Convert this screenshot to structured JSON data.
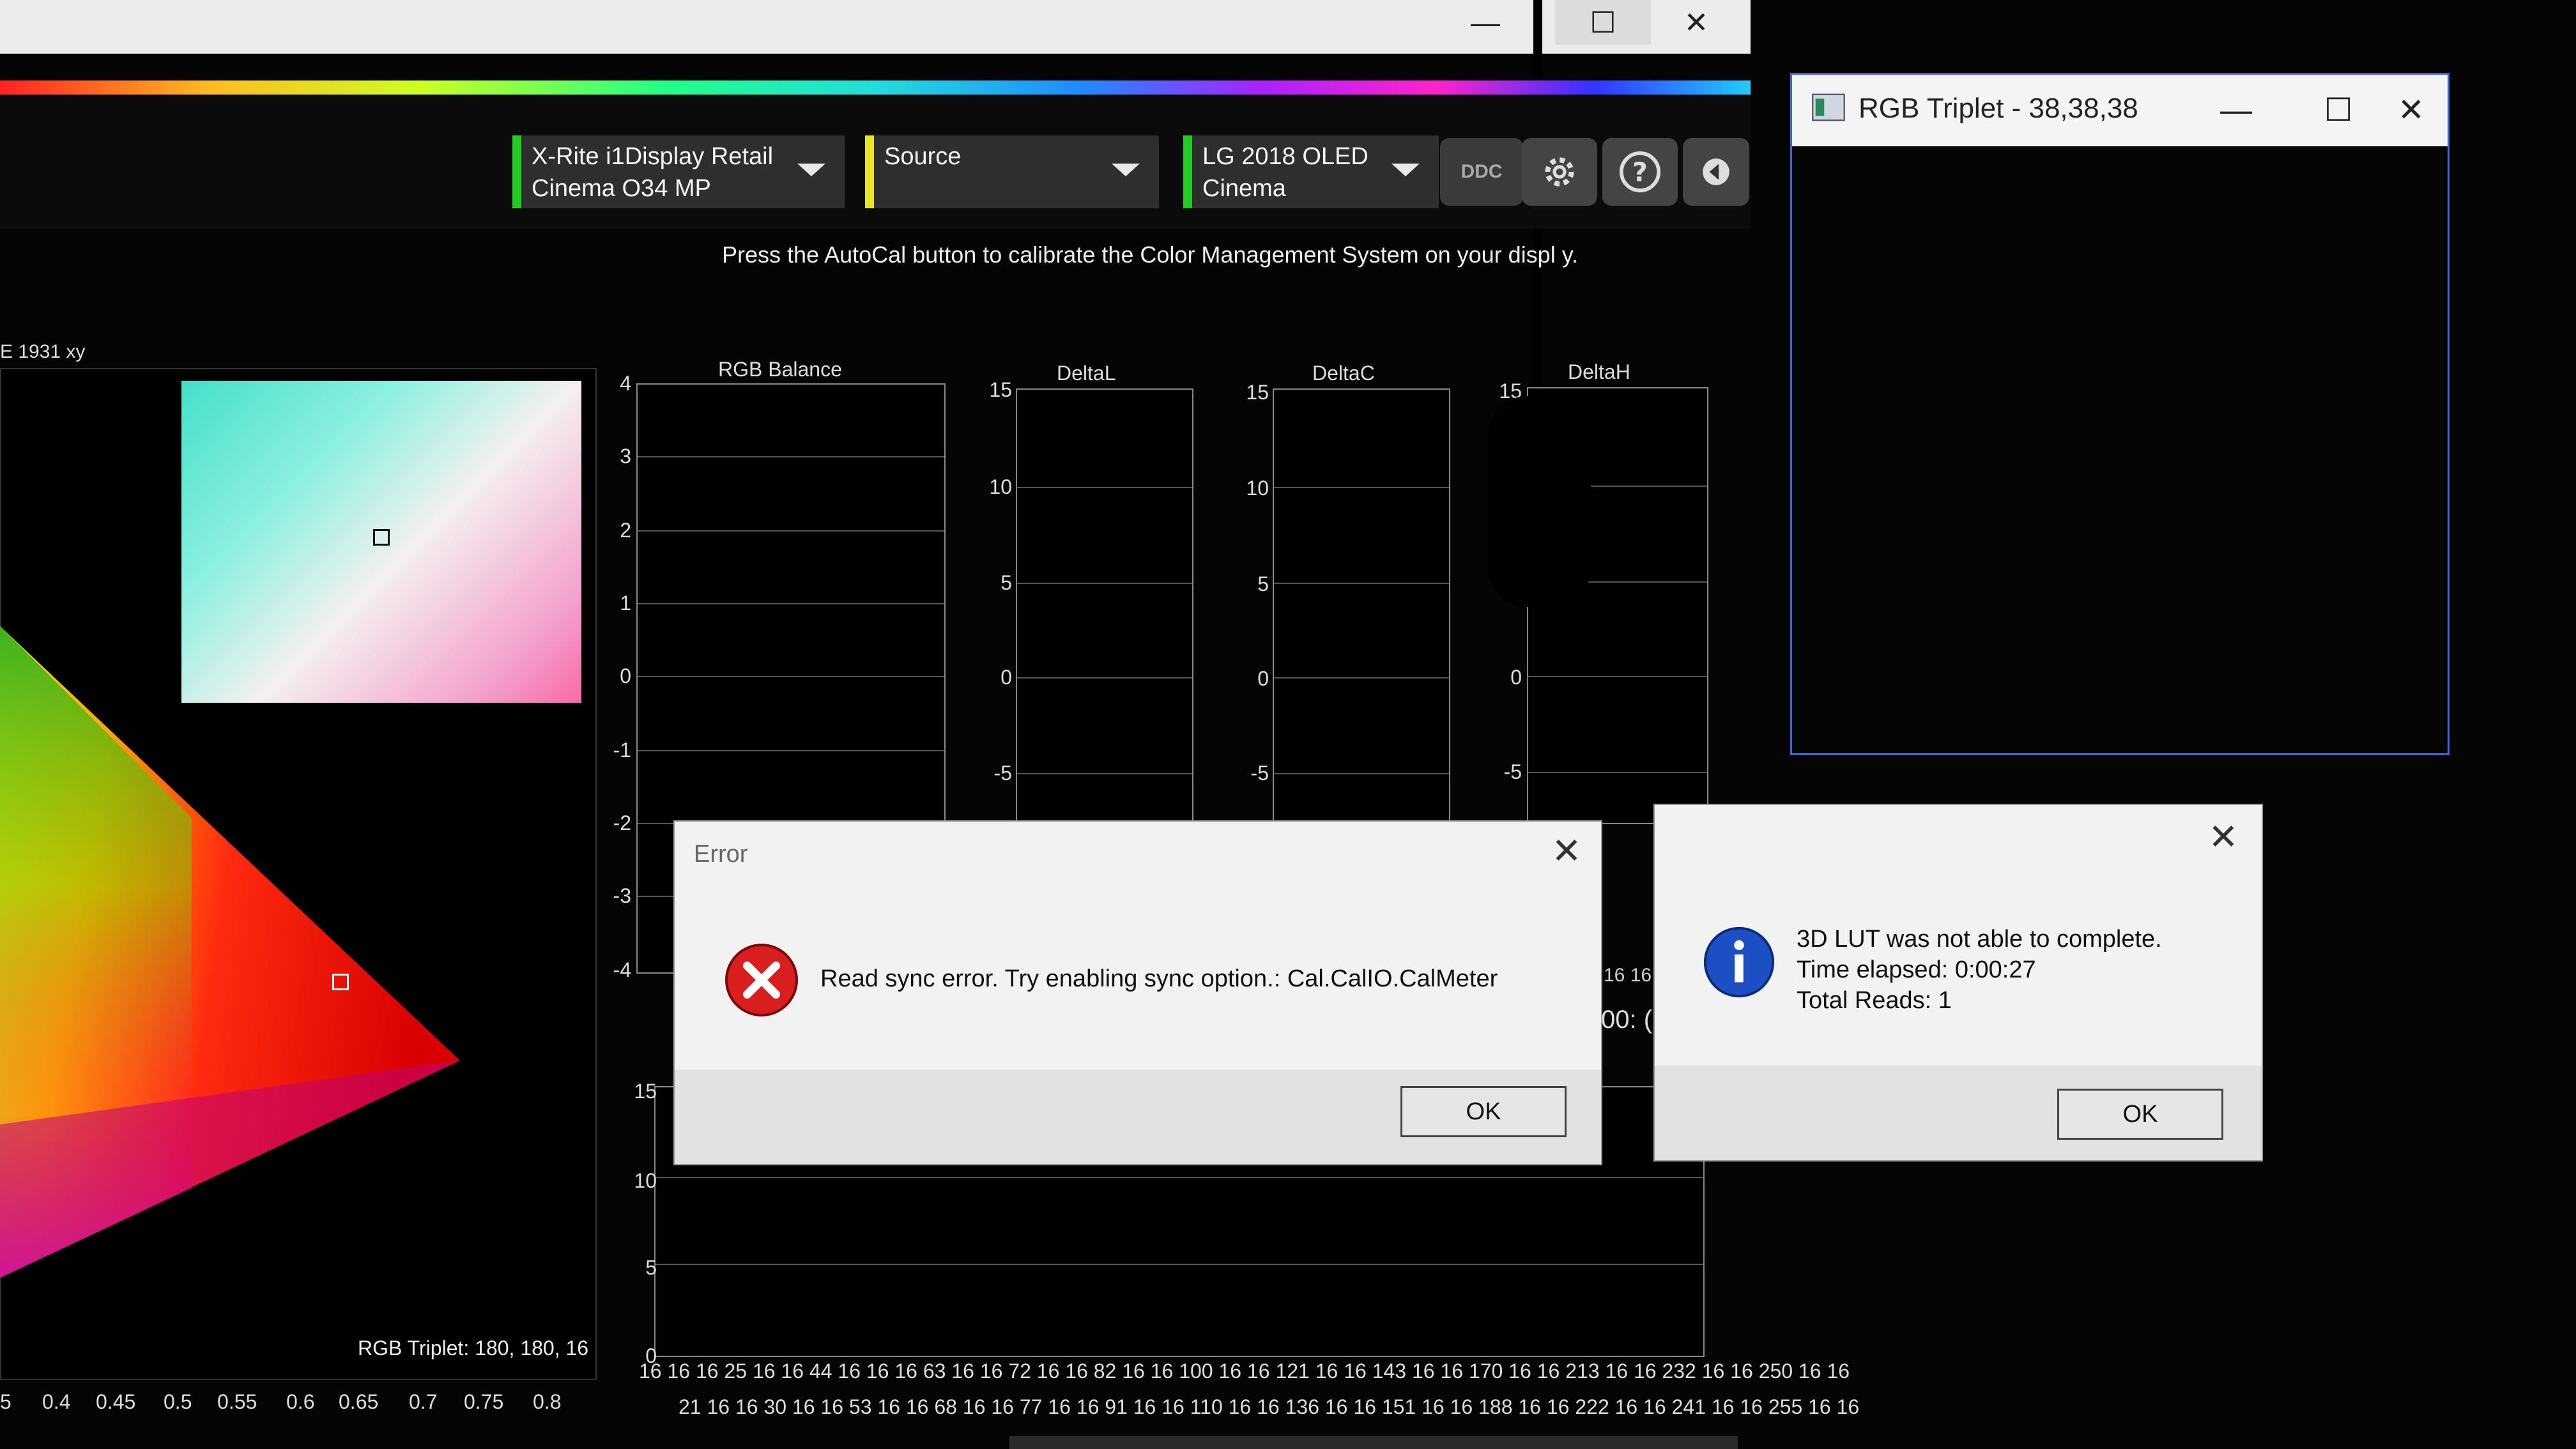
{
  "main_window": {
    "minimize": "—",
    "maximize": "☐",
    "close": "✕"
  },
  "toolbar": {
    "meter": {
      "line1": "X-Rite i1Display Retail",
      "line2": "Cinema O34 MP",
      "led_color": "#22cc22"
    },
    "source": {
      "label": "Source",
      "led_color": "#e6e622"
    },
    "display": {
      "line1": "LG 2018 OLED",
      "line2": "Cinema",
      "led_color": "#22cc22"
    },
    "ddc_label": "DDC",
    "settings_icon": "gear-icon",
    "help_icon": "question-icon",
    "back_icon": "chevron-left-icon"
  },
  "instruction": "Press the AutoCal button to calibrate the Color Management System on your displ y.",
  "cie": {
    "label": "E 1931 xy",
    "triplet_label": "RGB Triplet: 180, 180, 16",
    "x_ticks": [
      "5",
      "0.4",
      "0.45",
      "0.5",
      "0.55",
      "0.6",
      "0.65",
      "0.7",
      "0.75",
      "0.8"
    ]
  },
  "charts": {
    "rgb_balance": {
      "title": "RGB Balance",
      "ticks": [
        "4",
        "3",
        "2",
        "1",
        "0",
        "-1",
        "-2",
        "-3",
        "-4"
      ]
    },
    "deltaL": {
      "title": "DeltaL",
      "ticks": [
        "15",
        "10",
        "5",
        "0",
        "-5"
      ]
    },
    "deltaC": {
      "title": "DeltaC",
      "ticks": [
        "15",
        "10",
        "5",
        "0",
        "-5"
      ]
    },
    "deltaH": {
      "title": "DeltaH",
      "ticks": [
        "15",
        "",
        "",
        "0",
        "-5"
      ]
    },
    "bottom": {
      "ticks": [
        "15",
        "10",
        "5",
        "0"
      ]
    }
  },
  "x_row1": "16 16 16 25 16 16 44 16 16 16 63 16 16 72 16 16 82 16 16 100 16 16 121 16 16 143 16 16 170 16 16 213 16 16 232 16 16 250 16 16",
  "x_row2": "21 16 16 30 16 16 53 16 16 68 16 16 77 16 16 91 16 16 110 16 16 136 16 16 151 16 16 188 16 16 222 16 16 241 16 16 255 16 16",
  "partial_values": {
    "v1": "16 16",
    "v2": "00: ("
  },
  "error_dialog": {
    "title": "Error",
    "message": "Read sync error. Try enabling sync option.: Cal.CalIO.CalMeter",
    "ok": "OK",
    "icon": "error-icon"
  },
  "info_dialog": {
    "line1": "3D LUT was not able to complete.",
    "line2": "Time elapsed: 0:00:27",
    "line3": "Total Reads: 1",
    "ok": "OK",
    "icon": "info-icon"
  },
  "rgb_window": {
    "title": "RGB Triplet - 38,38,38",
    "minimize": "—",
    "maximize": "☐",
    "close": "✕"
  }
}
